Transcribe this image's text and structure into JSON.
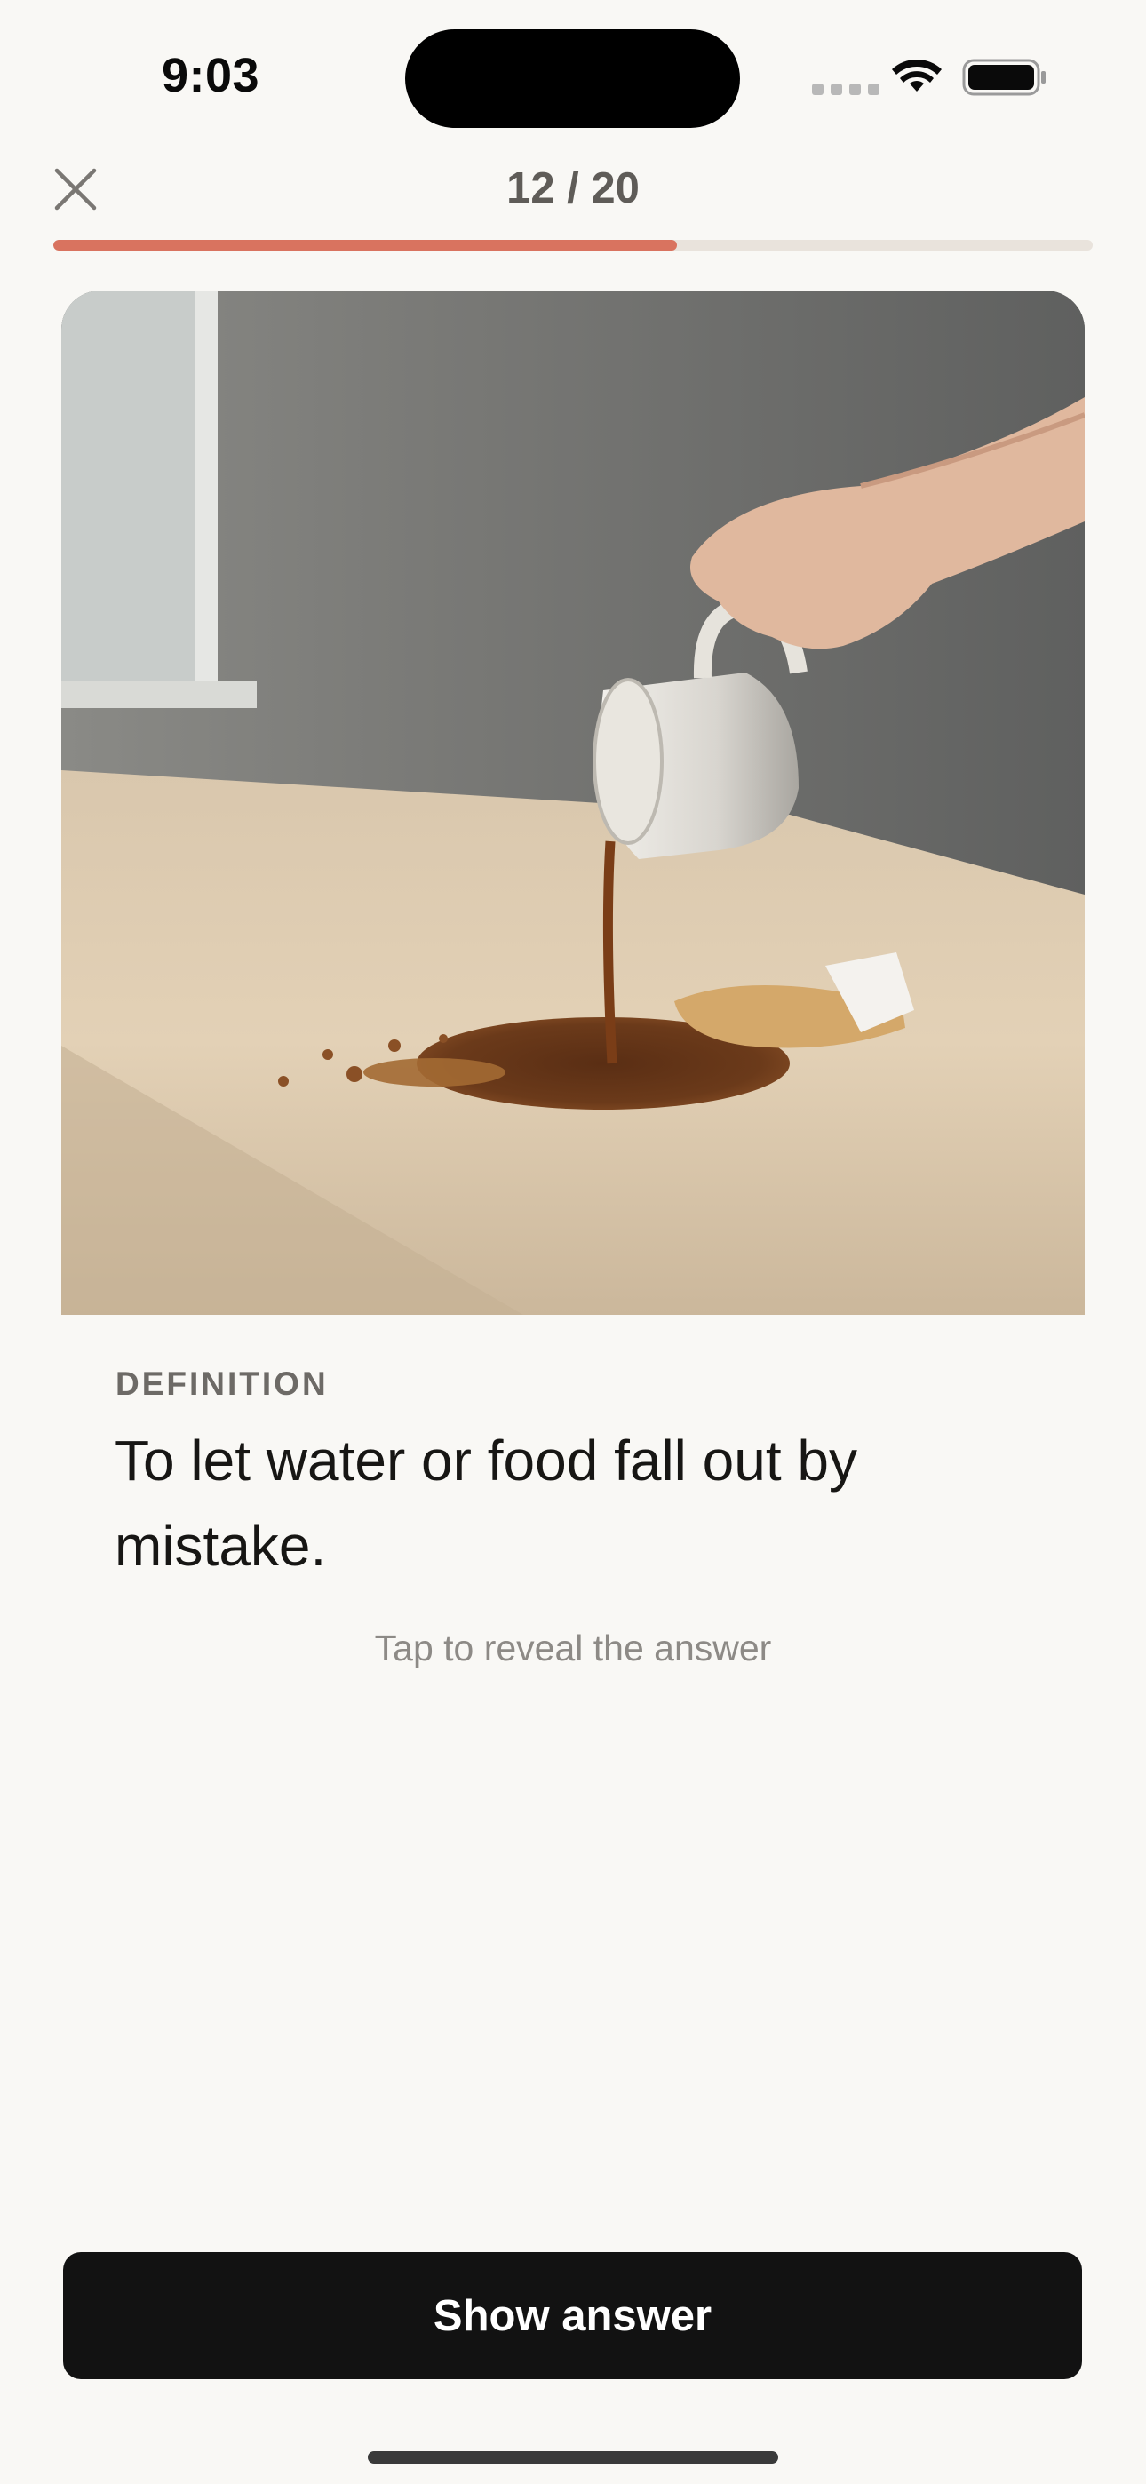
{
  "status_bar": {
    "time": "9:03",
    "icons": [
      "cellular-signal-icon",
      "wifi-icon",
      "battery-icon"
    ]
  },
  "header": {
    "close_icon": "close-icon",
    "progress_text": "12 / 20",
    "progress_fraction": 0.6
  },
  "card": {
    "image_description_icon": "coffee-spill-photo",
    "definition_label": "DEFINITION",
    "definition_text": "To let water or food fall out by mistake.",
    "reveal_hint": "Tap to reveal the answer"
  },
  "footer": {
    "show_answer_label": "Show answer"
  },
  "colors": {
    "accent": "#d9735f",
    "track": "#e9e3dc",
    "button_bg": "#121212",
    "background": "#f9f8f5"
  }
}
